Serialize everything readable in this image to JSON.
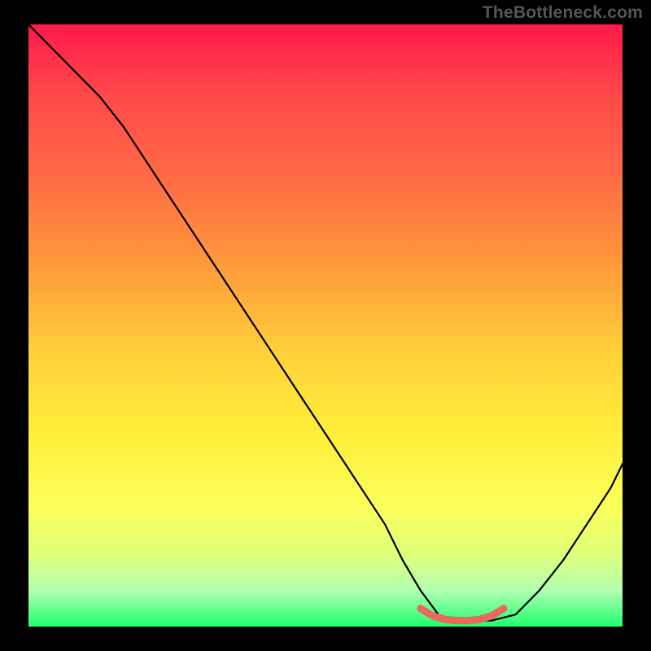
{
  "watermark": "TheBottleneck.com",
  "chart_data": {
    "type": "line",
    "title": "",
    "xlabel": "",
    "ylabel": "",
    "xlim": [
      0,
      100
    ],
    "ylim": [
      0,
      100
    ],
    "series": [
      {
        "name": "curve",
        "x": [
          0,
          4,
          8,
          12,
          16,
          20,
          24,
          28,
          32,
          36,
          40,
          44,
          48,
          52,
          56,
          60,
          63,
          66,
          69,
          72,
          75,
          78,
          82,
          86,
          90,
          94,
          98,
          100
        ],
        "values": [
          100,
          96,
          92,
          88,
          83,
          77,
          71,
          65,
          59,
          53,
          47,
          41,
          35,
          29,
          23,
          17,
          11,
          6,
          2,
          1,
          1,
          1,
          2,
          6,
          11,
          17,
          23,
          27
        ]
      },
      {
        "name": "highlight",
        "x": [
          66,
          68,
          70,
          72,
          74,
          76,
          78,
          80
        ],
        "values": [
          3,
          1.8,
          1.2,
          1.0,
          1.0,
          1.2,
          1.8,
          3
        ]
      }
    ],
    "colors": {
      "curve": "#000000",
      "highlight": "#e86a5a"
    }
  }
}
